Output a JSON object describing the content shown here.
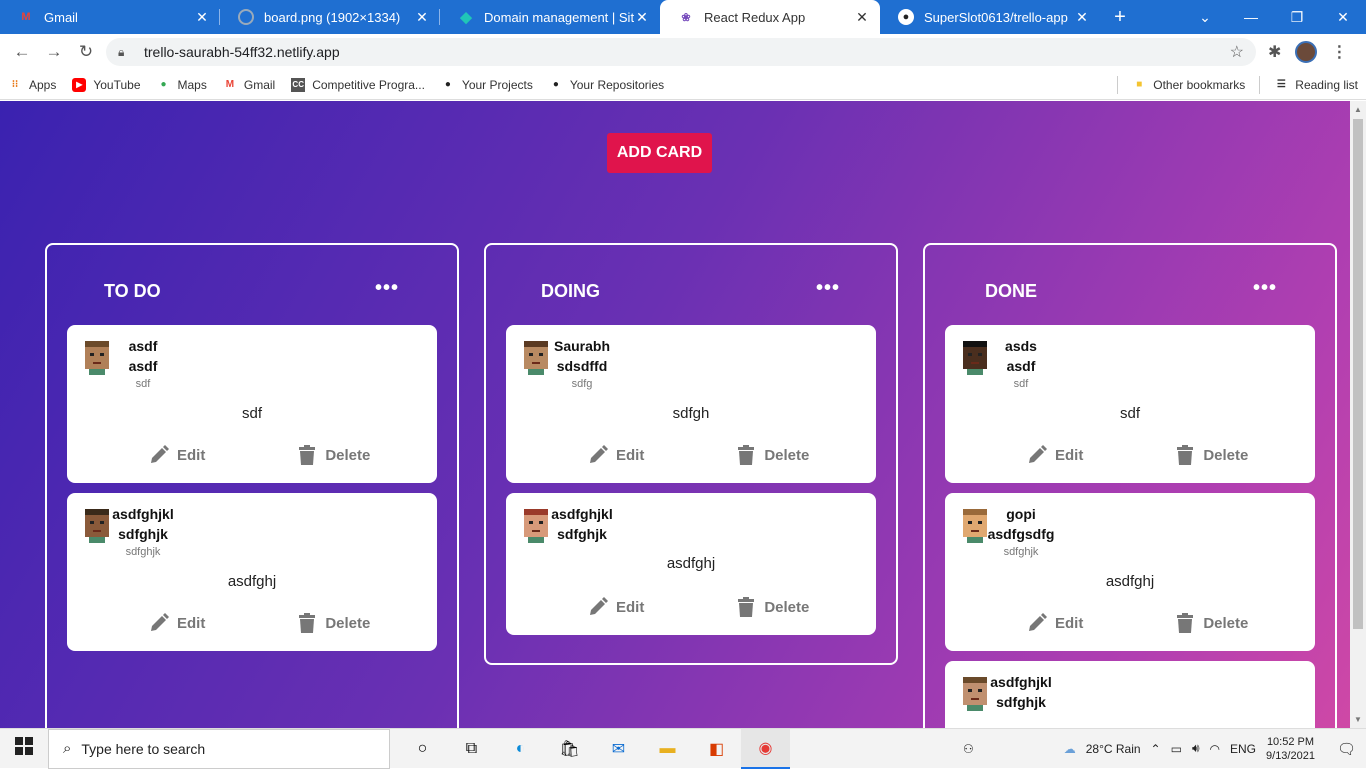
{
  "browser": {
    "tabs": [
      {
        "title": "Gmail",
        "icon": "gmail-icon"
      },
      {
        "title": "board.png (1902×1334)",
        "icon": "image-icon"
      },
      {
        "title": "Domain management | Site se",
        "icon": "netlify-icon"
      },
      {
        "title": "React Redux App",
        "icon": "redux-icon",
        "active": true
      },
      {
        "title": "SuperSlot0613/trello-app",
        "icon": "github-icon"
      }
    ],
    "new_tab": "+",
    "url": "trello-saurabh-54ff32.netlify.app",
    "bookmarks": [
      "Apps",
      "YouTube",
      "Maps",
      "Gmail",
      "Competitive Progra...",
      "Your Projects",
      "Your Repositories"
    ],
    "other_bookmarks": "Other bookmarks",
    "reading_list": "Reading list"
  },
  "app": {
    "add_card": "ADD CARD",
    "menu_glyph": "•••",
    "edit_label": "Edit",
    "delete_label": "Delete",
    "accent_color": "#e0144c",
    "columns": [
      {
        "title": "TO DO",
        "cards": [
          {
            "title": "asdf",
            "subtitle": "asdf",
            "meta": "sdf",
            "description": "sdf"
          },
          {
            "title": "asdfghjkl",
            "subtitle": "sdfghjk",
            "meta": "sdfghjk",
            "description": "asdfghj"
          }
        ]
      },
      {
        "title": "DOING",
        "cards": [
          {
            "title": "Saurabh",
            "subtitle": "sdsdffd",
            "meta": "sdfg",
            "description": "sdfgh"
          },
          {
            "title": "asdfghjkl",
            "subtitle": "sdfghjk",
            "meta": "",
            "description": "asdfghj"
          }
        ]
      },
      {
        "title": "DONE",
        "cards": [
          {
            "title": "asds",
            "subtitle": "asdf",
            "meta": "sdf",
            "description": "sdf"
          },
          {
            "title": "gopi",
            "subtitle": "asdfgsdfg",
            "meta": "sdfghjk",
            "description": "asdfghj"
          },
          {
            "title": "asdfghjkl",
            "subtitle": "sdfghjk",
            "meta": "",
            "description": ""
          }
        ]
      }
    ]
  },
  "taskbar": {
    "search_placeholder": "Type here to search",
    "weather": "28°C  Rain",
    "language": "ENG",
    "time": "10:52 PM",
    "date": "9/13/2021"
  }
}
